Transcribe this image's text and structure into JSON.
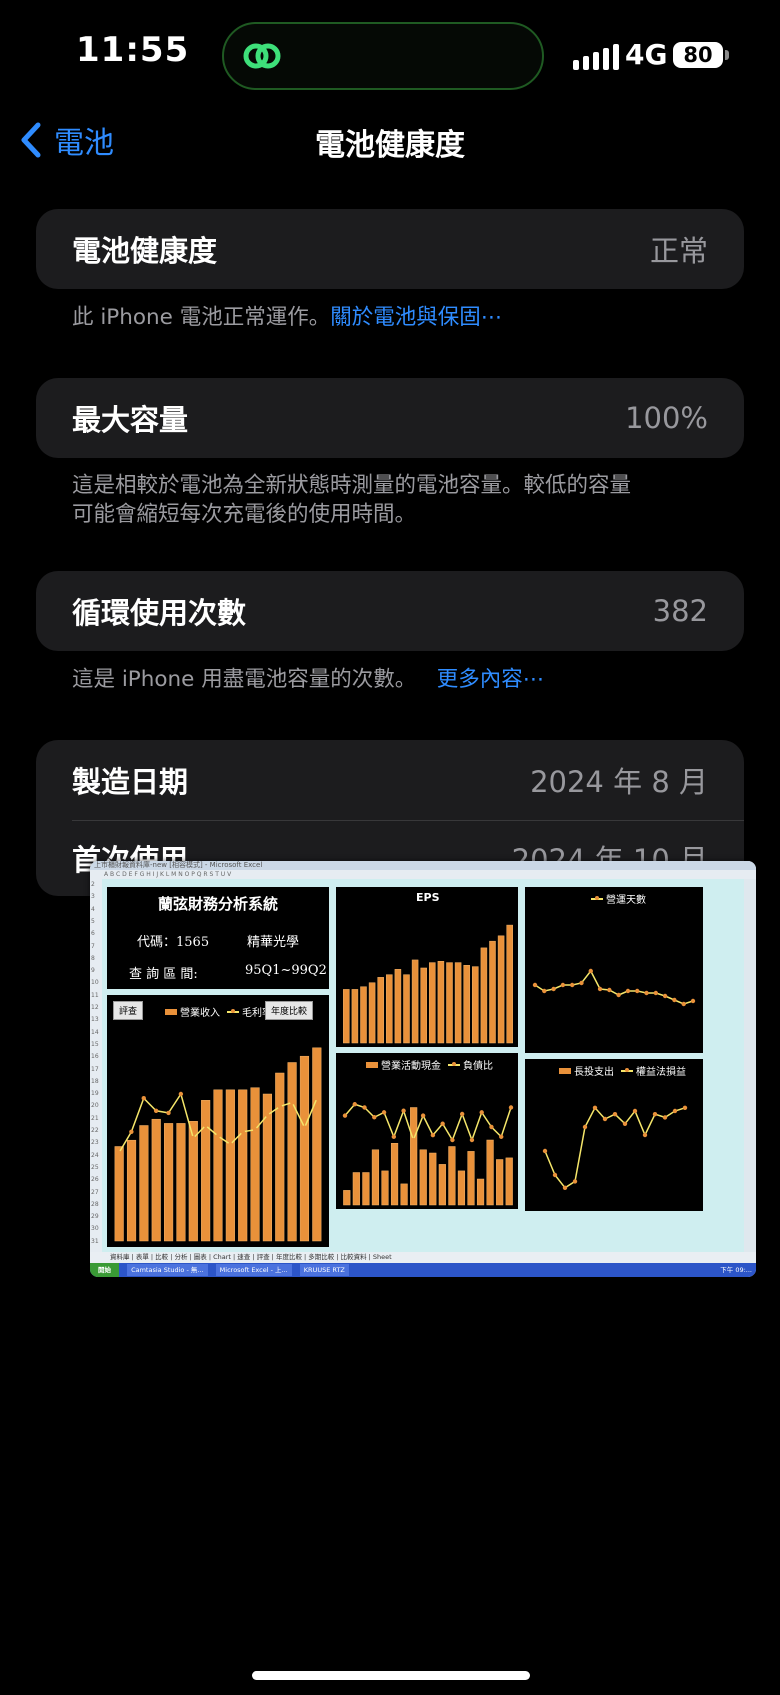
{
  "status": {
    "time": "11:55",
    "network": "4G",
    "battery": "80"
  },
  "nav": {
    "back": "電池",
    "title": "電池健康度"
  },
  "health": {
    "label": "電池健康度",
    "value": "正常",
    "note": "此 iPhone 電池正常運作。",
    "note_link": "關於電池與保固⋯"
  },
  "capacity": {
    "label": "最大容量",
    "value": "100%",
    "note1": "這是相較於電池為全新狀態時測量的電池容量。較低的容量",
    "note2": "可能會縮短每次充電後的使用時間。"
  },
  "cycles": {
    "label": "循環使用次數",
    "value": "382",
    "note": "這是 iPhone 用盡電池容量的次數。",
    "note_link": "更多內容⋯"
  },
  "dates": {
    "mfg_label": "製造日期",
    "mfg_value": "2024 年 8 月",
    "first_label": "首次使用",
    "first_value": "2024 年 10 月"
  },
  "excel": {
    "window_title": "上市櫃財報資料庫-new [相容模式] - Microsoft Excel",
    "system_title": "蘭弦財務分析系統",
    "code_line": "代碼：1565",
    "company": "精華光學",
    "range_label": "查 詢 區 間:",
    "range_value": "95Q1~99Q2",
    "btn_review": "評查",
    "btn_yearly": "年度比較",
    "legend_revenue": "營業收入",
    "legend_margin": "毛利率",
    "eps_title": "EPS",
    "days_title": "營運天數",
    "legend_cashflow": "營業活動現金",
    "legend_debt": "負債比",
    "legend_capex": "長投支出",
    "legend_equity": "權益法損益",
    "sheet_tabs": "資料庫 | 表單 | 比較 | 分析 | 圖表 | Chart | 速查 | 評查 | 年度比較 | 多期比較 | 比較資料 | Sheet",
    "start": "開始",
    "task1": "Camtasia Studio - 無...",
    "task2": "Microsoft Excel - 上...",
    "task3": "KRUUSE RTZ",
    "clock": "下午 09:..."
  },
  "chart_data": [
    {
      "type": "bar",
      "title": "",
      "series": [
        {
          "name": "營業收入",
          "type": "bar",
          "values": [
            45,
            48,
            55,
            58,
            56,
            56,
            57,
            67,
            72,
            72,
            72,
            73,
            70,
            80,
            85,
            88,
            92
          ]
        },
        {
          "name": "毛利率",
          "type": "line",
          "values": [
            42,
            52,
            68,
            62,
            61,
            70,
            49,
            55,
            50,
            46,
            52,
            53,
            60,
            64,
            66,
            54,
            68
          ]
        }
      ]
    },
    {
      "type": "bar",
      "title": "EPS",
      "values": [
        0.4,
        0.4,
        0.42,
        0.45,
        0.49,
        0.51,
        0.55,
        0.51,
        0.62,
        0.56,
        0.6,
        0.61,
        0.6,
        0.6,
        0.58,
        0.57,
        0.71,
        0.76,
        0.8,
        0.88
      ]
    },
    {
      "type": "line",
      "title": "營運天數",
      "series": [
        {
          "name": "營運天數",
          "values": [
            62,
            56,
            58,
            62,
            62,
            64,
            76,
            58,
            57,
            52,
            56,
            56,
            54,
            54,
            51,
            47,
            43,
            46
          ]
        }
      ]
    },
    {
      "type": "bar",
      "title": "",
      "series": [
        {
          "name": "營業活動現金",
          "type": "bar",
          "values": [
            9,
            20,
            20,
            34,
            21,
            38,
            13,
            60,
            34,
            32,
            25,
            36,
            21,
            33,
            16,
            40,
            28,
            29
          ]
        },
        {
          "name": "負債比",
          "type": "line",
          "values": [
            55,
            62,
            60,
            54,
            57,
            42,
            58,
            40,
            55,
            43,
            50,
            40,
            56,
            40,
            57,
            48,
            42,
            60
          ]
        }
      ]
    },
    {
      "type": "line",
      "title": "",
      "series": [
        {
          "name": "權益法損益",
          "values": [
            35,
            20,
            12,
            16,
            50,
            62,
            55,
            58,
            52,
            60,
            45,
            58,
            56,
            60,
            62
          ]
        }
      ]
    }
  ]
}
